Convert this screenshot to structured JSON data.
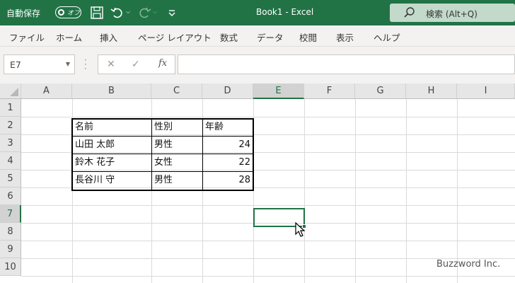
{
  "titlebar": {
    "autosave_label": "自動保存",
    "autosave_state": "オフ",
    "document_title": "Book1  -  Excel",
    "search_placeholder": "検索 (Alt+Q)"
  },
  "ribbon": {
    "tabs": [
      "ファイル",
      "ホーム",
      "挿入",
      "ページ レイアウト",
      "数式",
      "データ",
      "校閲",
      "表示",
      "ヘルプ"
    ]
  },
  "formula_bar": {
    "name_box": "E7",
    "cancel_glyph": "✕",
    "enter_glyph": "✓",
    "fx_label": "fx",
    "formula_value": ""
  },
  "grid": {
    "columns": [
      "A",
      "B",
      "C",
      "D",
      "E",
      "F",
      "G",
      "H",
      "I"
    ],
    "rows": [
      "1",
      "2",
      "3",
      "4",
      "5",
      "6",
      "7",
      "8",
      "9",
      "10"
    ],
    "active_cell": "E7",
    "active_column": "E",
    "active_row": "7"
  },
  "table": {
    "headers": [
      "名前",
      "性別",
      "年齢"
    ],
    "rows": [
      [
        "山田 太郎",
        "男性",
        "24"
      ],
      [
        "鈴木 花子",
        "女性",
        "22"
      ],
      [
        "長谷川 守",
        "男性",
        "28"
      ]
    ]
  },
  "watermark": "Buzzword Inc.",
  "colors": {
    "accent": "#217346",
    "search_bg": "#c3dacb"
  }
}
